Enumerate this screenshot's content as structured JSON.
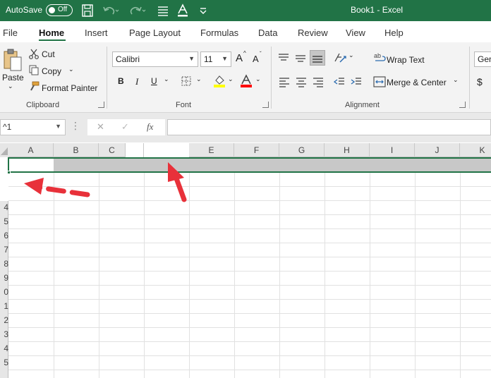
{
  "titlebar": {
    "autosave_label": "AutoSave",
    "autosave_state": "Off",
    "doc_title": "Book1  -  Excel",
    "color": "#217346"
  },
  "tabs": [
    "File",
    "Home",
    "Insert",
    "Page Layout",
    "Formulas",
    "Data",
    "Review",
    "View",
    "Help"
  ],
  "active_tab": "Home",
  "clipboard": {
    "paste": "Paste",
    "cut": "Cut",
    "copy": "Copy",
    "format_painter": "Format Painter",
    "group": "Clipboard"
  },
  "font": {
    "name": "Calibri",
    "size": "11",
    "grow": "A",
    "shrink": "A",
    "bold": "B",
    "italic": "I",
    "underline": "U",
    "font_color_letter": "A",
    "group": "Font",
    "highlight_color": "#ffff00",
    "text_color": "#ff0000"
  },
  "alignment": {
    "wrap_text": "Wrap Text",
    "merge_center": "Merge & Center",
    "group": "Alignment"
  },
  "number": {
    "format_partial": "Gen",
    "currency": "$"
  },
  "formula_bar": {
    "name_box": "^1",
    "cancel": "✕",
    "enter": "✓",
    "fx": "fx",
    "value": ""
  },
  "columns": [
    "A",
    "B",
    "C",
    "",
    "E",
    "F",
    "G",
    "H",
    "I",
    "J",
    "K"
  ],
  "rows": [
    "4",
    "5",
    "6",
    "7",
    "8",
    "9",
    "0",
    "1",
    "2",
    "3",
    "4",
    "5"
  ],
  "annotation_color": "#e8313a"
}
